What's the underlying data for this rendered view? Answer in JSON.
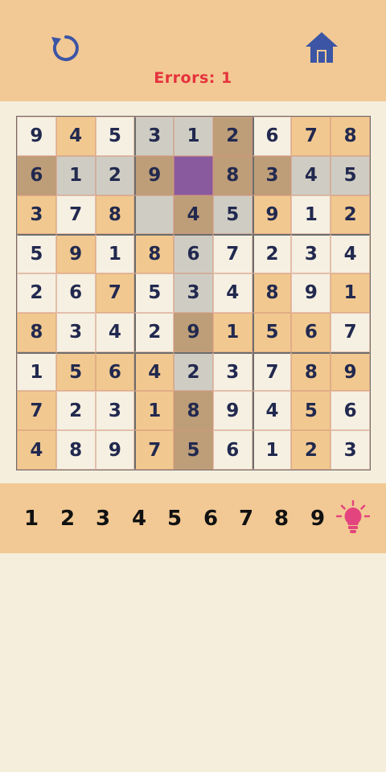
{
  "header": {
    "restart_icon": "restart-icon",
    "home_icon": "home-icon",
    "errors_text": "Errors: 1",
    "colors": {
      "icon": "#3c55a5",
      "errors": "#e5333d",
      "bar": "#f2c994"
    }
  },
  "board": {
    "values": [
      [
        "9",
        "4",
        "5",
        "3",
        "1",
        "2",
        "6",
        "7",
        "8"
      ],
      [
        "6",
        "1",
        "2",
        "9",
        "",
        "8",
        "3",
        "4",
        "5"
      ],
      [
        "3",
        "7",
        "8",
        "",
        "4",
        "5",
        "9",
        "1",
        "2"
      ],
      [
        "5",
        "9",
        "1",
        "8",
        "6",
        "7",
        "2",
        "3",
        "4"
      ],
      [
        "2",
        "6",
        "7",
        "5",
        "3",
        "4",
        "8",
        "9",
        "1"
      ],
      [
        "8",
        "3",
        "4",
        "2",
        "9",
        "1",
        "5",
        "6",
        "7"
      ],
      [
        "1",
        "5",
        "6",
        "4",
        "2",
        "3",
        "7",
        "8",
        "9"
      ],
      [
        "7",
        "2",
        "3",
        "1",
        "8",
        "9",
        "4",
        "5",
        "6"
      ],
      [
        "4",
        "8",
        "9",
        "7",
        "5",
        "6",
        "1",
        "2",
        "3"
      ]
    ],
    "shading": [
      [
        "light",
        "tan",
        "light",
        "gray",
        "gray",
        "dark",
        "light",
        "tan",
        "tan"
      ],
      [
        "dark",
        "gray",
        "gray",
        "dark",
        "selected",
        "dark",
        "dark",
        "gray",
        "gray"
      ],
      [
        "tan",
        "light",
        "tan",
        "gray",
        "dark",
        "gray",
        "tan",
        "light",
        "tan"
      ],
      [
        "light",
        "tan",
        "light",
        "tan",
        "gray",
        "light",
        "light",
        "light",
        "light"
      ],
      [
        "light",
        "light",
        "tan",
        "light",
        "gray",
        "light",
        "tan",
        "light",
        "tan"
      ],
      [
        "tan",
        "light",
        "light",
        "light",
        "dark",
        "tan",
        "tan",
        "tan",
        "light"
      ],
      [
        "light",
        "tan",
        "tan",
        "tan",
        "gray",
        "light",
        "light",
        "tan",
        "tan"
      ],
      [
        "tan",
        "light",
        "light",
        "tan",
        "dark",
        "light",
        "light",
        "tan",
        "light"
      ],
      [
        "tan",
        "light",
        "light",
        "tan",
        "dark",
        "light",
        "light",
        "tan",
        "light"
      ]
    ],
    "selected_cell": "row 2, column 5",
    "colors": {
      "digit": "#22294f",
      "selected": "#8a5a9e"
    }
  },
  "numpad": {
    "digits": [
      "1",
      "2",
      "3",
      "4",
      "5",
      "6",
      "7",
      "8",
      "9"
    ],
    "hint_icon": "lightbulb-icon",
    "colors": {
      "hint": "#e4447e"
    }
  }
}
